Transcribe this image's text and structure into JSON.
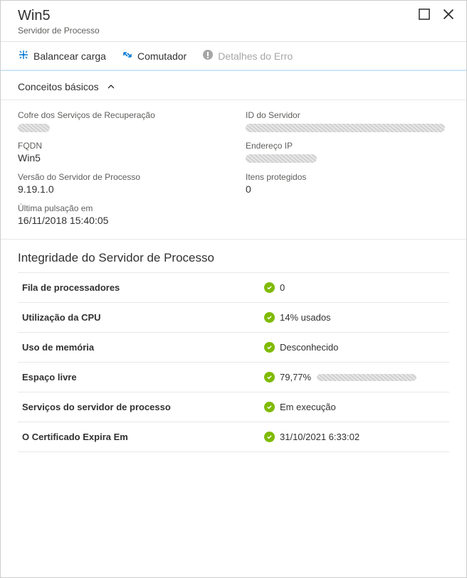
{
  "window": {
    "title": "Win5",
    "subtitle": "Servidor de Processo"
  },
  "toolbar": {
    "balance_label": "Balancear carga",
    "switch_label": "Comutador",
    "errors_label": "Detalhes do Erro"
  },
  "basics": {
    "header": "Conceitos básicos",
    "vault_label": "Cofre dos Serviços de Recuperação",
    "server_id_label": "ID do Servidor",
    "fqdn_label": "FQDN",
    "fqdn_value": "Win5",
    "ip_label": "Endereço IP",
    "version_label": "Versão do Servidor de Processo",
    "version_value": "9.19.1.0",
    "protected_label": "Itens protegidos",
    "protected_value": "0",
    "heartbeat_label": "Última pulsação em",
    "heartbeat_value": "16/11/2018 15:40:05"
  },
  "health": {
    "title": "Integridade do Servidor de Processo",
    "rows": [
      {
        "label": "Fila de processadores",
        "value": "0"
      },
      {
        "label": "Utilização da CPU",
        "value": "14% usados"
      },
      {
        "label": "Uso de memória",
        "value": "Desconhecido"
      },
      {
        "label": "Espaço livre",
        "value": "79,77%"
      },
      {
        "label": "Serviços do servidor de processo",
        "value": "Em execução"
      },
      {
        "label": "O Certificado Expira Em",
        "value": "31/10/2021 6:33:02"
      }
    ]
  }
}
